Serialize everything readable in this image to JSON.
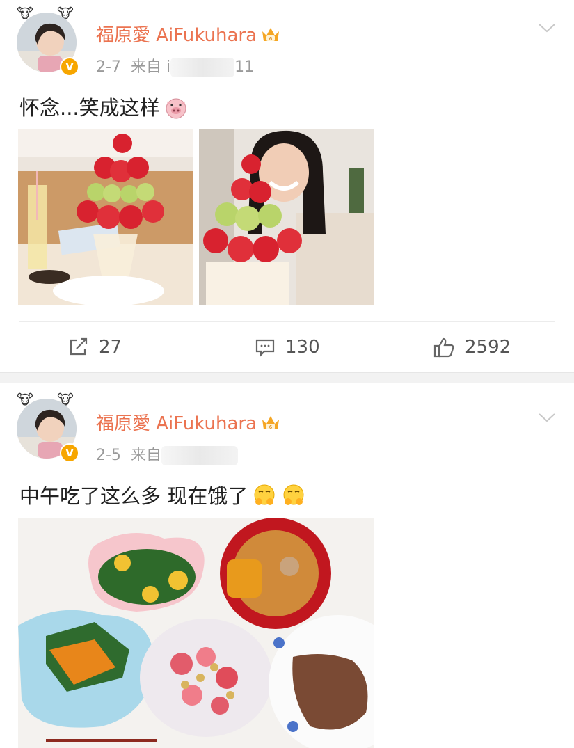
{
  "posts": [
    {
      "author": "福原愛 AiFukuhara",
      "date": "2-7",
      "source_prefix": "来自",
      "source_visible": "i",
      "source_suffix": "11",
      "text": "怀念...笑成这样",
      "text_emoji": "pig-face",
      "images": [
        "parfait-photo-left",
        "parfait-selfie-photo"
      ],
      "actions": {
        "repost": "27",
        "comment": "130",
        "like": "2592"
      }
    },
    {
      "author": "福原愛 AiFukuhara",
      "date": "2-5",
      "source_prefix": "来自",
      "text": "中午吃了这么多 现在饿了",
      "text_emoji": "hungry-face",
      "images": [
        "lunch-dishes-photo"
      ]
    }
  ],
  "colors": {
    "username": "#eb7350",
    "meta": "#9a9a9a",
    "verified_badge": "#f7a600"
  },
  "icons": [
    "avatar",
    "verified-badge",
    "vip-crown-icon",
    "chevron-down-icon",
    "repost-icon",
    "comment-icon",
    "like-icon"
  ]
}
